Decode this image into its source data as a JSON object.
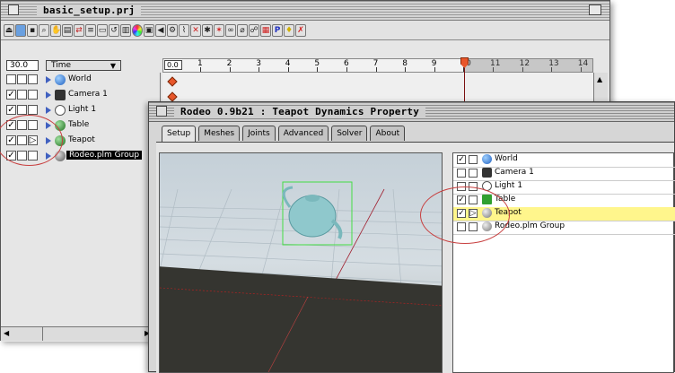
{
  "back_window": {
    "title": "basic_setup.prj",
    "frame_rate": "30.0",
    "time_mode": "Time",
    "time_field": "0.0",
    "ruler_ticks": [
      "1",
      "2",
      "3",
      "4",
      "5",
      "6",
      "7",
      "8",
      "9",
      "10",
      "11",
      "12",
      "13",
      "14"
    ],
    "rows": [
      {
        "label": "World",
        "checked": false,
        "icon": "globe-icon"
      },
      {
        "label": "Camera 1",
        "checked": true,
        "icon": "camera-icon"
      },
      {
        "label": "Light 1",
        "checked": true,
        "icon": "light-icon"
      },
      {
        "label": "Table",
        "checked": true,
        "icon": "green-ball-icon"
      },
      {
        "label": "Teapot",
        "checked": true,
        "icon": "green-ball-icon"
      },
      {
        "label": "Rodeo.plm Group",
        "checked": true,
        "icon": "group-icon"
      }
    ]
  },
  "front_window": {
    "title": "Rodeo 0.9b21 : Teapot Dynamics Property",
    "tabs": [
      "Setup",
      "Meshes",
      "Joints",
      "Advanced",
      "Solver",
      "About"
    ],
    "active_tab": "Setup",
    "objects": [
      {
        "label": "World",
        "checked": true,
        "icon": "globe-icon"
      },
      {
        "label": "Camera 1",
        "checked": false,
        "icon": "camera-icon"
      },
      {
        "label": "Light 1",
        "checked": false,
        "icon": "light-icon"
      },
      {
        "label": "Table",
        "checked": true,
        "icon": "green-cube-icon"
      },
      {
        "label": "Teapot",
        "checked": true,
        "icon": "sphere-icon",
        "highlighted": true
      },
      {
        "label": "Rodeo.plm Group",
        "checked": false,
        "icon": "sphere-icon"
      }
    ]
  },
  "colors": {
    "keyframe": "#e8562a",
    "highlight_row": "#fff68c",
    "annotation_circle": "#c84040",
    "teapot": "#8fc8cc",
    "selection_box": "#44dd44"
  }
}
